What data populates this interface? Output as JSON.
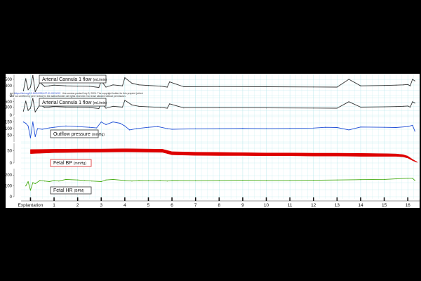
{
  "notice": {
    "prefix": "doi:",
    "link": "https://doi.org/10.1101/2024.07.01.XXXXXX",
    "line1": "this version posted July 3, 2024. The copyright holder for this preprint (which",
    "line2": "was not certified by peer review) is the author/funder. All rights reserved. No reuse allowed without permission."
  },
  "colors": {
    "background": "#000000",
    "panel": "#ffffff",
    "grid": "#b8e8ec",
    "flow1": "#333333",
    "flow2": "#333333",
    "outflow": "#1f4fd6",
    "fetal_bp": "#dd0000",
    "fetal_hr": "#44aa11",
    "legend_bp_border": "#dd2222"
  },
  "chart_data": {
    "type": "line",
    "x_axis": {
      "ticks": [
        {
          "x": 0,
          "label": "Explantation"
        },
        {
          "x": 1,
          "label": "1"
        },
        {
          "x": 2,
          "label": "2"
        },
        {
          "x": 3,
          "label": "3"
        },
        {
          "x": 4,
          "label": "4"
        },
        {
          "x": 5,
          "label": "5"
        },
        {
          "x": 6,
          "label": "6"
        },
        {
          "x": 7,
          "label": "7"
        },
        {
          "x": 8,
          "label": "8"
        },
        {
          "x": 9,
          "label": "9"
        },
        {
          "x": 10,
          "label": "10"
        },
        {
          "x": 11,
          "label": "11"
        },
        {
          "x": 12,
          "label": "12"
        },
        {
          "x": 13,
          "label": "13"
        },
        {
          "x": 14,
          "label": "14"
        },
        {
          "x": 15,
          "label": "15"
        },
        {
          "x": 16,
          "label": "16"
        }
      ],
      "xlim": [
        -0.4,
        16.5
      ],
      "grid": true
    },
    "panels": [
      {
        "id": "flow1",
        "legend_title": "Arterial Cannula 1 flow",
        "legend_unit": "(mL/min)",
        "ylim": [
          0,
          650
        ],
        "yticks": [
          {
            "v": 0,
            "label": "0"
          },
          {
            "v": 300,
            "label": "300"
          },
          {
            "v": 500,
            "label": "500"
          }
        ],
        "series": [
          {
            "color_key": "flow1",
            "x": [
              -0.3,
              -0.2,
              -0.1,
              0.0,
              0.1,
              0.2,
              0.3,
              0.4,
              0.6,
              0.8,
              1.0,
              1.5,
              2.0,
              2.5,
              2.9,
              3.0,
              3.2,
              3.5,
              3.9,
              4.0,
              4.3,
              4.6,
              5.0,
              5.5,
              5.8,
              5.9,
              6.5,
              8.0,
              10.0,
              12.0,
              13.0,
              13.5,
              14.0,
              15.0,
              15.5,
              15.8,
              16.0,
              16.1,
              16.2,
              16.3
            ],
            "y": [
              150,
              520,
              180,
              260,
              620,
              120,
              250,
              400,
              280,
              300,
              320,
              300,
              290,
              285,
              250,
              450,
              260,
              330,
              300,
              550,
              380,
              330,
              310,
              290,
              260,
              420,
              270,
              275,
              270,
              265,
              260,
              500,
              300,
              310,
              320,
              330,
              340,
              300,
              500,
              450
            ]
          }
        ]
      },
      {
        "id": "flow2",
        "legend_title": "Arterial Cannula 1 flow",
        "legend_unit": "(mL/min)",
        "ylim": [
          0,
          650
        ],
        "yticks": [
          {
            "v": 0,
            "label": "0"
          },
          {
            "v": 300,
            "label": "300"
          },
          {
            "v": 500,
            "label": "500"
          }
        ],
        "series": [
          {
            "color_key": "flow2",
            "x": [
              -0.3,
              -0.2,
              -0.1,
              0.0,
              0.1,
              0.2,
              0.3,
              0.4,
              0.6,
              0.8,
              1.0,
              1.5,
              2.0,
              2.5,
              2.9,
              3.0,
              3.2,
              3.5,
              3.9,
              4.0,
              4.3,
              4.6,
              5.0,
              5.5,
              5.8,
              5.9,
              6.5,
              8.0,
              10.0,
              12.0,
              13.0,
              13.5,
              14.0,
              15.0,
              15.5,
              15.8,
              16.0,
              16.1,
              16.2,
              16.3
            ],
            "y": [
              150,
              520,
              180,
              260,
              620,
              120,
              250,
              400,
              280,
              300,
              320,
              300,
              290,
              285,
              250,
              450,
              260,
              330,
              300,
              550,
              380,
              330,
              310,
              290,
              260,
              420,
              270,
              275,
              270,
              265,
              260,
              500,
              300,
              310,
              320,
              330,
              340,
              300,
              500,
              450
            ]
          }
        ]
      },
      {
        "id": "outflow",
        "legend_title": "Outflow pressure",
        "legend_unit": "(mmHg)",
        "ylim": [
          0,
          190
        ],
        "yticks": [
          {
            "v": 50,
            "label": "50"
          },
          {
            "v": 100,
            "label": "100"
          },
          {
            "v": 150,
            "label": "150"
          }
        ],
        "series": [
          {
            "color_key": "outflow",
            "x": [
              -0.3,
              -0.2,
              -0.1,
              0.0,
              0.1,
              0.2,
              0.3,
              0.5,
              0.8,
              1.0,
              1.5,
              2.0,
              2.5,
              2.8,
              3.0,
              3.2,
              3.5,
              3.8,
              4.0,
              4.2,
              4.5,
              5.0,
              5.4,
              5.8,
              6.0,
              7.0,
              8.0,
              9.0,
              10.0,
              11.0,
              12.0,
              12.5,
              13.0,
              13.5,
              14.0,
              15.0,
              15.5,
              16.0,
              16.2,
              16.3
            ],
            "y": [
              150,
              140,
              120,
              30,
              150,
              40,
              100,
              95,
              105,
              110,
              120,
              115,
              110,
              105,
              150,
              130,
              150,
              140,
              120,
              90,
              100,
              110,
              115,
              100,
              95,
              98,
              100,
              102,
              100,
              102,
              104,
              110,
              108,
              90,
              112,
              110,
              108,
              115,
              125,
              80
            ]
          }
        ]
      },
      {
        "id": "fetal_bp",
        "legend_title": "Fetal BP",
        "legend_unit": "(mmHg)",
        "ylim": [
          0,
          80
        ],
        "yticks": [
          {
            "v": 0,
            "label": "0"
          },
          {
            "v": 50,
            "label": "50"
          }
        ],
        "series": [
          {
            "color_key": "fetal_bp",
            "band": true,
            "x": [
              0.0,
              1.0,
              2.0,
              3.0,
              4.0,
              5.0,
              5.6,
              6.0,
              7.0,
              8.0,
              9.0,
              10.0,
              11.0,
              12.0,
              13.0,
              14.0,
              15.0,
              15.5,
              15.8,
              16.0,
              16.2,
              16.4
            ],
            "y_low": [
              38,
              42,
              43,
              44,
              45,
              44,
              43,
              33,
              31,
              30,
              30,
              29,
              29,
              28,
              28,
              27,
              27,
              27,
              25,
              20,
              10,
              2
            ],
            "y_high": [
              55,
              56,
              57,
              57,
              58,
              57,
              56,
              46,
              44,
              43,
              42,
              41,
              41,
              40,
              40,
              39,
              38,
              37,
              34,
              28,
              15,
              4
            ]
          }
        ]
      },
      {
        "id": "fetal_hr",
        "legend_title": "Fetal HR",
        "legend_unit": "(BPM)",
        "ylim": [
          0,
          260
        ],
        "yticks": [
          {
            "v": 0,
            "label": "0"
          },
          {
            "v": 100,
            "label": "100"
          },
          {
            "v": 200,
            "label": "200"
          }
        ],
        "series": [
          {
            "color_key": "fetal_hr",
            "x": [
              -0.2,
              -0.1,
              0.0,
              0.1,
              0.2,
              0.4,
              0.6,
              0.8,
              1.0,
              1.2,
              1.5,
              2.0,
              2.3,
              2.6,
              3.0,
              3.2,
              3.5,
              4.0,
              4.3,
              4.6,
              5.0,
              5.5,
              5.8,
              6.0,
              7.0,
              8.0,
              9.0,
              10.0,
              11.0,
              12.0,
              13.0,
              14.0,
              15.0,
              15.5,
              16.0,
              16.2,
              16.3
            ],
            "y": [
              100,
              140,
              60,
              130,
              120,
              150,
              145,
              140,
              150,
              145,
              160,
              155,
              150,
              145,
              140,
              155,
              160,
              150,
              145,
              150,
              148,
              150,
              145,
              150,
              148,
              150,
              152,
              150,
              150,
              152,
              155,
              158,
              160,
              165,
              170,
              170,
              150
            ]
          }
        ]
      }
    ]
  }
}
